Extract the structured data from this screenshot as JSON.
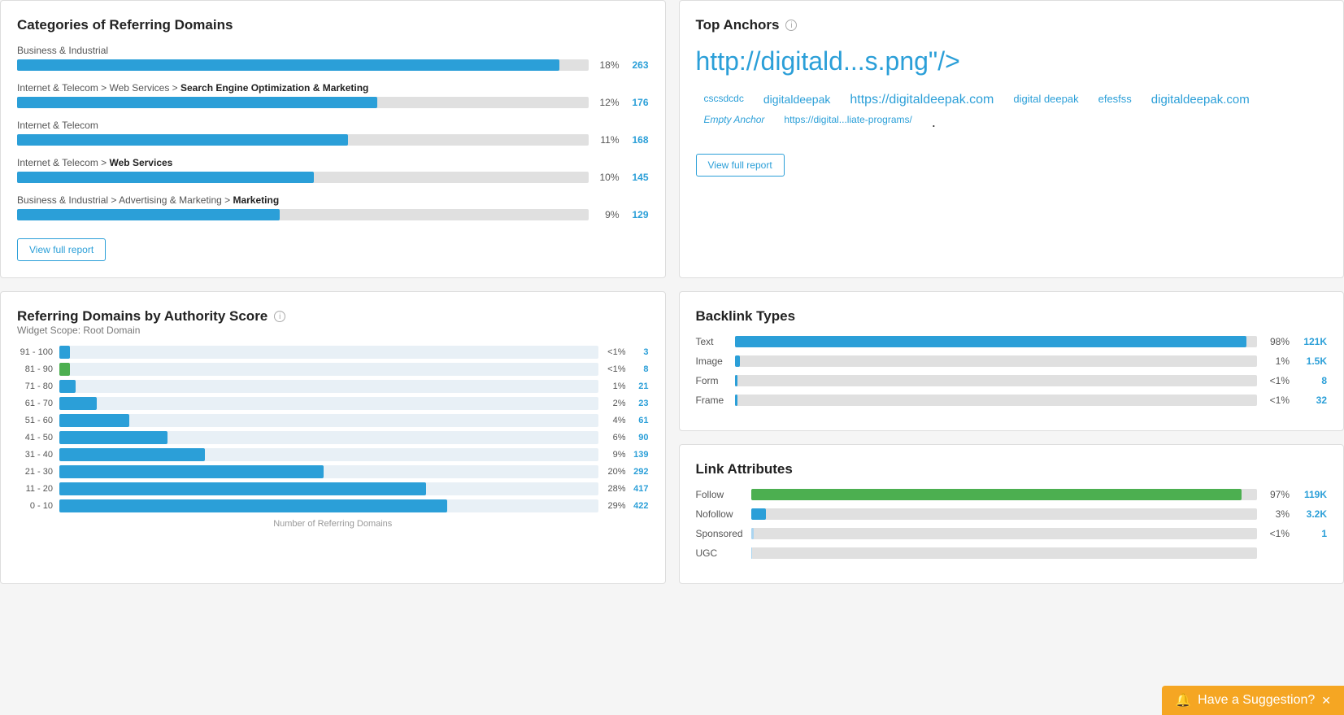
{
  "categories": {
    "title": "Categories of Referring Domains",
    "view_button": "View full report",
    "items": [
      {
        "label": "Business &amp; Industrial",
        "bold": "",
        "percent": "18%",
        "count": "263",
        "fill_pct": 95
      },
      {
        "label": "Internet &amp; Telecom &gt; Web Services &gt; ",
        "bold": "Search Engine Optimization &amp; Marketing",
        "percent": "12%",
        "count": "176",
        "fill_pct": 63
      },
      {
        "label": "Internet &amp; Telecom",
        "bold": "",
        "percent": "11%",
        "count": "168",
        "fill_pct": 58
      },
      {
        "label": "Internet &amp; Telecom &gt; ",
        "bold": "Web Services",
        "percent": "10%",
        "count": "145",
        "fill_pct": 52
      },
      {
        "label": "Business &amp; Industrial &gt; Advertising &amp; Marketing &gt; ",
        "bold": "Marketing",
        "percent": "9%",
        "count": "129",
        "fill_pct": 46
      }
    ]
  },
  "top_anchors": {
    "title": "Top Anchors",
    "main_anchor": "http://digitald...s.png&quot;/&gt;",
    "view_button": "View full report",
    "tags": [
      {
        "text": "cscsdcdc",
        "style": "normal"
      },
      {
        "text": "digitaldeepak",
        "style": "normal"
      },
      {
        "text": "https://digitaldeepak.com",
        "style": "normal"
      },
      {
        "text": "digital deepak",
        "style": "normal"
      },
      {
        "text": "efesfss",
        "style": "normal"
      },
      {
        "text": "digitaldeepak.com",
        "style": "normal"
      },
      {
        "text": "Empty Anchor",
        "style": "italic"
      },
      {
        "text": "https://digital...liate-programs/",
        "style": "normal"
      },
      {
        "text": ".",
        "style": "dot"
      }
    ]
  },
  "authority": {
    "title": "Referring Domains by Authority Score",
    "info": "i",
    "subtitle": "Widget Scope: Root Domain",
    "x_label": "Number of Referring Domains",
    "rows": [
      {
        "label": "91 - 100",
        "fill_pct": 2,
        "color": "blue",
        "pct": "<1%",
        "count": "3"
      },
      {
        "label": "81 - 90",
        "fill_pct": 2,
        "color": "green",
        "pct": "<1%",
        "count": "8"
      },
      {
        "label": "71 - 80",
        "fill_pct": 3,
        "color": "blue",
        "pct": "1%",
        "count": "21"
      },
      {
        "label": "61 - 70",
        "fill_pct": 7,
        "color": "blue",
        "pct": "2%",
        "count": "23"
      },
      {
        "label": "51 - 60",
        "fill_pct": 13,
        "color": "blue",
        "pct": "4%",
        "count": "61"
      },
      {
        "label": "41 - 50",
        "fill_pct": 20,
        "color": "blue",
        "pct": "6%",
        "count": "90"
      },
      {
        "label": "31 - 40",
        "fill_pct": 27,
        "color": "blue",
        "pct": "9%",
        "count": "139"
      },
      {
        "label": "21 - 30",
        "fill_pct": 49,
        "color": "blue",
        "pct": "20%",
        "count": "292"
      },
      {
        "label": "11 - 20",
        "fill_pct": 68,
        "color": "blue",
        "pct": "28%",
        "count": "417"
      },
      {
        "label": "0 - 10",
        "fill_pct": 72,
        "color": "blue",
        "pct": "29%",
        "count": "422"
      }
    ]
  },
  "backlink_types": {
    "title": "Backlink Types",
    "rows": [
      {
        "label": "Text",
        "fill_pct": 98,
        "pct": "98%",
        "count": "121K"
      },
      {
        "label": "Image",
        "fill_pct": 1,
        "pct": "1%",
        "count": "1.5K"
      },
      {
        "label": "Form",
        "fill_pct": 0.5,
        "pct": "<1%",
        "count": "8"
      },
      {
        "label": "Frame",
        "fill_pct": 0.5,
        "pct": "<1%",
        "count": "32"
      }
    ]
  },
  "link_attributes": {
    "title": "Link Attributes",
    "rows": [
      {
        "label": "Follow",
        "fill_pct": 97,
        "color": "green",
        "pct": "97%",
        "count": "119K"
      },
      {
        "label": "Nofollow",
        "fill_pct": 3,
        "color": "blue",
        "pct": "3%",
        "count": "3.2K"
      },
      {
        "label": "Sponsored",
        "fill_pct": 0.5,
        "color": "light",
        "pct": "<1%",
        "count": "1"
      },
      {
        "label": "UGC",
        "fill_pct": 0.3,
        "color": "light",
        "pct": "",
        "count": ""
      }
    ]
  },
  "suggestion": {
    "label": "Have a Suggestion?",
    "icon": "🔔"
  }
}
